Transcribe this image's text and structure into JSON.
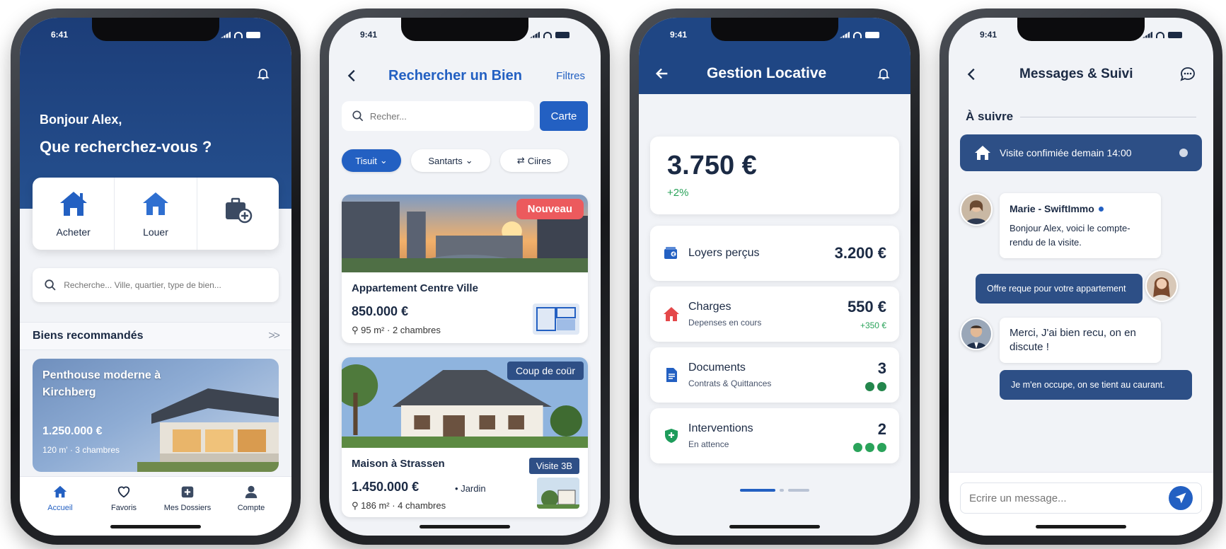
{
  "status": {
    "time_p1": "6:41",
    "time": "9:41"
  },
  "colors": {
    "primary": "#2360c2",
    "navy": "#1f4684",
    "green": "#2aa35a",
    "red": "#ec5a5d"
  },
  "home": {
    "greeting": "Bonjour Alex,",
    "question": "Que recherchez-vous ?",
    "actions": [
      {
        "label": "Acheter",
        "icon": "house-icon"
      },
      {
        "label": "Louer",
        "icon": "house-icon"
      },
      {
        "label": "",
        "icon": "briefcase-add-icon"
      }
    ],
    "search_placeholder": "Recherche... Ville, quartier, type de bien...",
    "section_title": "Biens recommandés",
    "more": ">>",
    "featured": {
      "title": "Penthouse moderne à Kirchberg",
      "price": "1.250.000 €",
      "meta": "120 m' · 3 chambres"
    },
    "tabs": [
      {
        "label": "Accueil",
        "icon": "house-icon",
        "active": true
      },
      {
        "label": "Favoris",
        "icon": "heart-icon",
        "active": false
      },
      {
        "label": "Mes Dossiers",
        "icon": "folder-plus-icon",
        "active": false
      },
      {
        "label": "Compte",
        "icon": "user-icon",
        "active": false
      }
    ]
  },
  "search": {
    "title": "Rechercher un Bien",
    "filters": "Filtres",
    "placeholder": "Recher...",
    "map_button": "Carte",
    "chips": [
      "Tisuit",
      "Santarts",
      "Ciires"
    ],
    "listings": [
      {
        "badge": "Nouveau",
        "name": "Appartement Centre Ville",
        "price": "850.000 €",
        "meta": "95 m² · 2 chambres"
      },
      {
        "badge": "Coup de coür",
        "name": "Maison à Strassen",
        "price": "1.450.000 €",
        "meta": "186 m² · 4 chambres",
        "tag": "Visite 3B",
        "extra": "Jardin"
      }
    ]
  },
  "rental": {
    "title": "Gestion Locative",
    "total": "3.750 €",
    "delta": "+2%",
    "rows": [
      {
        "label": "Loyers perçus",
        "sub": "",
        "value": "3.200 €",
        "value_sub": "",
        "icon": "wallet-icon",
        "dots": 0,
        "dot_color": "#2aa35a"
      },
      {
        "label": "Charges",
        "sub": "Depenses en cours",
        "value": "550 €",
        "value_sub": "+350 €",
        "icon": "house-icon",
        "dots": 0,
        "dot_color": "#2aa35a"
      },
      {
        "label": "Documents",
        "sub": "Contrats & Quittances",
        "value": "3",
        "value_sub": "",
        "icon": "document-icon",
        "dots": 2,
        "dot_color": "#23864c"
      },
      {
        "label": "Interventions",
        "sub": "En attence",
        "value": "2",
        "value_sub": "",
        "icon": "shield-icon",
        "dots": 3,
        "dot_color": "#2aa35a"
      }
    ]
  },
  "messages": {
    "title": "Messages & Suivi",
    "section": "À suivre",
    "banner": "Visite confimiée demain 14:00",
    "thread": [
      {
        "from": "Marie - SwiftImmo",
        "text": "Bonjour Alex, voici le compte-rendu de la visite."
      },
      {
        "from": "me",
        "text": "Offre reque pour votre appartement"
      },
      {
        "from": "agent",
        "text": "Merci, J'ai bien recu, on en discute !"
      },
      {
        "from": "me",
        "text": "Je m'en occupe, on se tient au caurant."
      }
    ],
    "composer_placeholder": "Ecrire un message..."
  }
}
